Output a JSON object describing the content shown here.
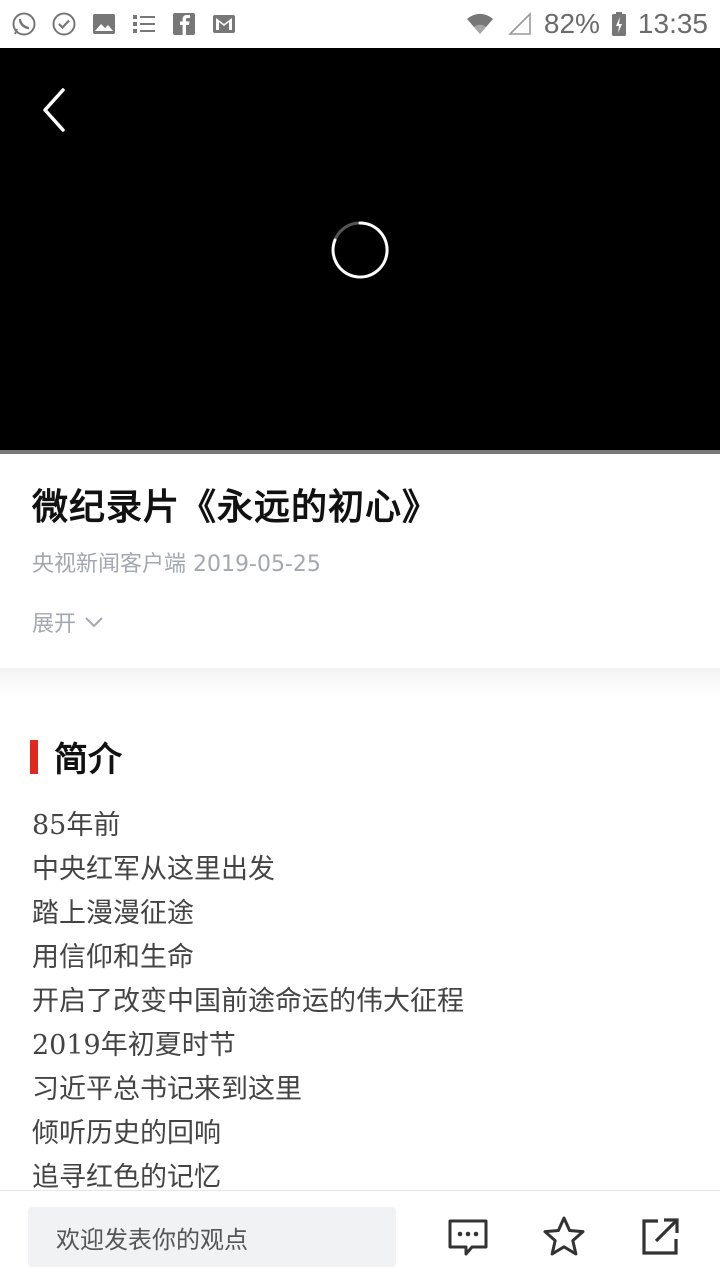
{
  "status_bar": {
    "battery": "82%",
    "time": "13:35",
    "left_icons": [
      "whatsapp-icon",
      "check-circle-icon",
      "image-icon",
      "list-icon",
      "facebook-icon",
      "gmail-icon"
    ],
    "right_icons": [
      "wifi-icon",
      "signal-icon",
      "battery-icon"
    ]
  },
  "player": {
    "back_icon": "chevron-left-icon",
    "loading_icon": "loading-spinner-icon"
  },
  "article": {
    "title": "微纪录片《永远的初心》",
    "source": "央视新闻客户端",
    "date": "2019-05-25",
    "expand_label": "展开"
  },
  "intro": {
    "heading": "简介",
    "lines": [
      "85年前",
      "中央红军从这里出发",
      "踏上漫漫征途",
      "用信仰和生命",
      "开启了改变中国前途命运的伟大征程",
      "2019年初夏时节",
      "习近平总书记来到这里",
      "倾听历史的回响",
      "追寻红色的记忆"
    ]
  },
  "bottom_bar": {
    "comment_placeholder": "欢迎发表你的观点",
    "icons": [
      "comment-icon",
      "star-icon",
      "share-icon"
    ]
  },
  "colors": {
    "accent_red": "#e12a1f",
    "meta_gray": "#a3a8b0",
    "player_bg": "#000000"
  }
}
